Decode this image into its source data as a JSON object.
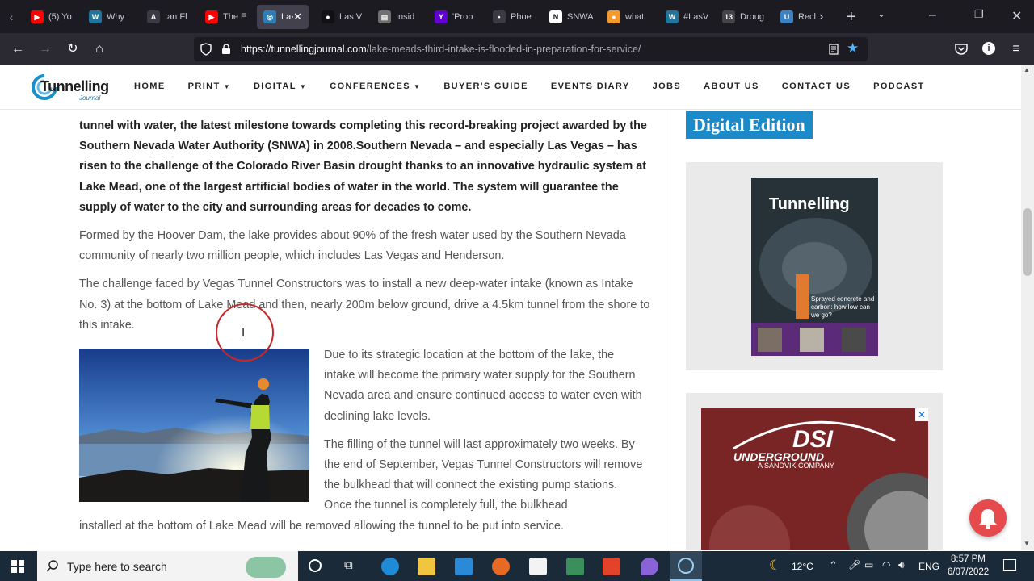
{
  "browser": {
    "tabs": [
      {
        "title": "(5) Yo",
        "icon": "youtube-icon",
        "color": "#ff0000",
        "glyph": "▶"
      },
      {
        "title": "Why",
        "icon": "wordpress-icon",
        "color": "#21759b",
        "glyph": "W"
      },
      {
        "title": "Ian Fl",
        "icon": "site-icon",
        "color": "#3a3944",
        "glyph": "A"
      },
      {
        "title": "The E",
        "icon": "youtube-icon",
        "color": "#ff0000",
        "glyph": "▶"
      },
      {
        "title": "Lak",
        "icon": "tunnelling-icon",
        "color": "#2a7fb8",
        "glyph": "◎"
      },
      {
        "title": "Las V",
        "icon": "site-icon",
        "color": "#111111",
        "glyph": "●"
      },
      {
        "title": "Insid",
        "icon": "document-icon",
        "color": "#6f6f6f",
        "glyph": "▤"
      },
      {
        "title": "'Prob",
        "icon": "yahoo-icon",
        "color": "#6001d2",
        "glyph": "Y"
      },
      {
        "title": "Phoe",
        "icon": "site-icon",
        "color": "#3a3944",
        "glyph": "•"
      },
      {
        "title": "SNWA",
        "icon": "notion-icon",
        "color": "#ffffff",
        "glyph": "N"
      },
      {
        "title": "what",
        "icon": "site-icon",
        "color": "#f39a2f",
        "glyph": "●"
      },
      {
        "title": "#LasV",
        "icon": "wordpress-icon",
        "color": "#21759b",
        "glyph": "W"
      },
      {
        "title": "Droug",
        "icon": "site-icon",
        "color": "#444444",
        "glyph": "13"
      },
      {
        "title": "Recl",
        "icon": "site-icon",
        "color": "#3b82c4",
        "glyph": "U"
      }
    ],
    "url_host": "https://tunnellingjournal.com",
    "url_path": "/lake-meads-third-intake-is-flooded-in-preparation-for-service/"
  },
  "site": {
    "logo_text": "Tunnelling",
    "logo_sub": "Journal",
    "menu": [
      {
        "label": "HOME",
        "dropdown": false
      },
      {
        "label": "PRINT",
        "dropdown": true
      },
      {
        "label": "DIGITAL",
        "dropdown": true
      },
      {
        "label": "CONFERENCES",
        "dropdown": true
      },
      {
        "label": "BUYER'S GUIDE",
        "dropdown": false
      },
      {
        "label": "EVENTS DIARY",
        "dropdown": false
      },
      {
        "label": "JOBS",
        "dropdown": false
      },
      {
        "label": "ABOUT US",
        "dropdown": false
      },
      {
        "label": "CONTACT US",
        "dropdown": false
      },
      {
        "label": "PODCAST",
        "dropdown": false
      }
    ]
  },
  "article": {
    "lead": "tunnel with water, the latest milestone towards completing this record-breaking project awarded by the Southern Nevada Water Authority (SNWA) in 2008.Southern Nevada – and especially Las Vegas – has risen to the challenge of the Colorado River Basin drought thanks to an innovative hydraulic system at Lake Mead, one of the largest artificial bodies of water in the world. The system will guarantee the supply of water to the city and surrounding areas for decades to come.",
    "p1": "Formed by the Hoover Dam, the lake provides about 90% of the fresh water used by the Southern Nevada community of nearly two million people, which includes Las Vegas and Henderson.",
    "p2": "The challenge faced by Vegas Tunnel Constructors was to install a new deep-water intake (known as Intake No. 3) at the bottom of Lake Mead and then, nearly 200m below ground, drive a 4.5km tunnel from the shore to this intake.",
    "p3": "Due to its strategic location at the bottom of the lake, the intake will become the primary water supply for the Southern Nevada area and ensure continued access to water even with declining lake levels.",
    "p4_wrapped": "The filling of the tunnel will last approximately two weeks. By the end of September, Vegas Tunnel Constructors will remove the bulkhead that will connect the existing pump stations. Once the tunnel is completely full, the bulkhead",
    "p4_full": "installed at the bottom of Lake Mead will be removed allowing the tunnel to be put into service."
  },
  "sidebar": {
    "title": "Digital Edition",
    "mag_brand": "Tunnelling",
    "mag_headline": "Sprayed concrete and carbon: how low can we go?",
    "ad_brand": "DSI",
    "ad_line1": "UNDERGROUND",
    "ad_line2": "A SANDVIK COMPANY"
  },
  "taskbar": {
    "search_placeholder": "Type here to search",
    "temperature": "12°C",
    "language": "ENG",
    "time": "8:57 PM",
    "date": "6/07/2022"
  }
}
